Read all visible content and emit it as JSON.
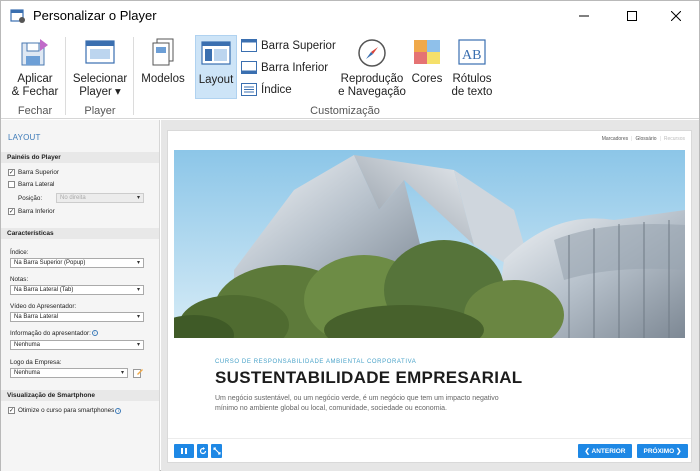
{
  "window": {
    "title": "Personalizar o Player"
  },
  "ribbon": {
    "apply": "Aplicar\n& Fechar",
    "apply_l1": "Aplicar",
    "apply_l2": "& Fechar",
    "group_close": "Fechar",
    "select_l1": "Selecionar",
    "select_l2": "Player",
    "group_player": "Player",
    "models": "Modelos",
    "layout": "Layout",
    "top_bar": "Barra Superior",
    "bottom_bar": "Barra Inferior",
    "index": "Índice",
    "playback_l1": "Reprodução",
    "playback_l2": "e Navegação",
    "colors": "Cores",
    "labels_l1": "Rótulos",
    "labels_l2": "de texto",
    "group_customization": "Customização"
  },
  "panel": {
    "header": "LAYOUT",
    "player_panels": "Painéis do Player",
    "top_bar": "Barra Superior",
    "side_bar": "Barra Lateral",
    "position_label": "Posição:",
    "position_value": "No direita",
    "bottom_bar": "Barra Inferior",
    "features": "Características",
    "index_label": "Índice:",
    "index_value": "Na Barra Superior (Popup)",
    "notes_label": "Notas:",
    "notes_value": "Na Barra Lateral (Tab)",
    "video_label": "Vídeo do Apresentador:",
    "video_value": "Na Barra Lateral",
    "info_label": "Informação do apresentador:",
    "info_value": "Nenhuma",
    "logo_label": "Logo da Empresa:",
    "logo_value": "Nenhuma",
    "smartphone_section": "Visualização de Smartphone",
    "optimize": "Otimize o curso para smartphones"
  },
  "player": {
    "links": [
      "Marcadores",
      "Glossário",
      "Recursos"
    ],
    "course": "CURSO DE RESPONSABILIDADE AMBIENTAL CORPORATIVA",
    "title": "SUSTENTABILIDADE EMPRESARIAL",
    "desc": "Um negócio sustentável, ou um negócio verde, é um negócio que tem um impacto negativo mínimo no ambiente global ou local, comunidade, sociedade ou economia.",
    "prev": "❮ ANTERIOR",
    "next": "PRÓXIMO ❯"
  },
  "colors": {
    "accent": "#1e88e5",
    "selected": "#cde4f7",
    "link": "#3c7ab8"
  }
}
